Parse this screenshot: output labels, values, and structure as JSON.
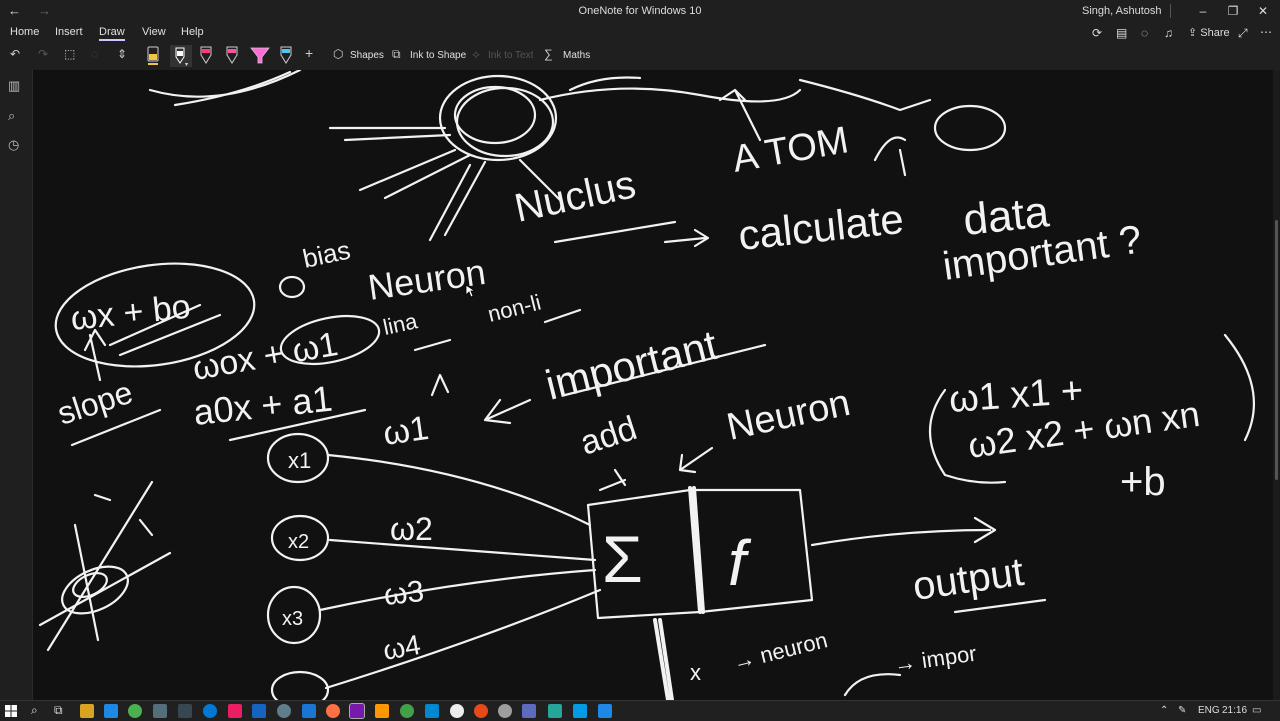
{
  "window": {
    "title": "OneNote for Windows 10",
    "user": "Singh, Ashutosh",
    "back_glyph": "←",
    "forward_glyph": "→",
    "minimize_glyph": "–",
    "restore_glyph": "❐",
    "close_glyph": "✕"
  },
  "menu": {
    "items": [
      "Home",
      "Insert",
      "Draw",
      "View",
      "Help"
    ],
    "active": "Draw"
  },
  "ribbon_right": {
    "share_label": "Share"
  },
  "toolbar": {
    "shapes_label": "Shapes",
    "ink_to_shape_label": "Ink to Shape",
    "ink_to_text_label": "Ink to Text",
    "maths_label": "Maths",
    "pen_colors": [
      "#f4c542",
      "#ffffff",
      "#ff3b7f",
      "#ff4fa3",
      "#ff6bd8",
      "#4fc3f7"
    ]
  },
  "taskbar": {
    "lang": "ENG",
    "time": "21:16"
  }
}
